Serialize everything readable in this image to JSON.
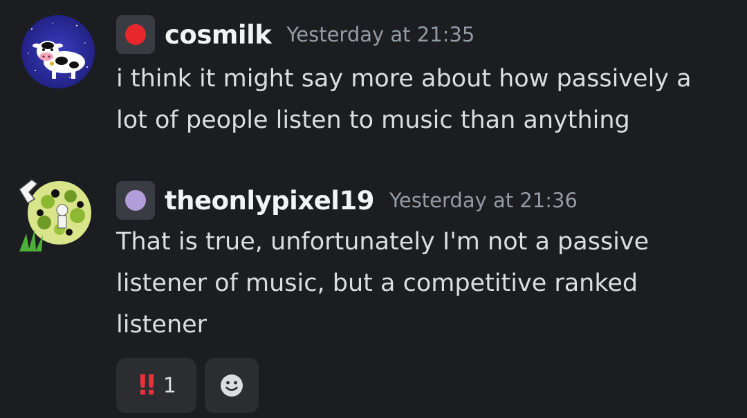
{
  "messages": [
    {
      "username": "cosmilk",
      "timestamp": "Yesterday at 21:35",
      "badge_color": "#e8272c",
      "lines": [
        "i think it might say more about how passively a",
        "lot of people listen to music than anything"
      ]
    },
    {
      "username": "theonlypixel19",
      "timestamp": "Yesterday at 21:36",
      "badge_color": "#b39ddb",
      "lines": [
        "That is true, unfortunately I'm not a passive",
        "listener of music, but a competitive ranked",
        "listener"
      ]
    }
  ],
  "reactions": [
    {
      "emoji": "!!",
      "emoji_icon": "double-exclamation-icon",
      "count": "1"
    }
  ],
  "add_reaction_icon": "smiley-face-icon",
  "colors": {
    "background": "#1c1d21",
    "username": "#f2f3f5",
    "timestamp": "#949ba4",
    "text": "#dbdee1",
    "reaction_bg": "#2b2d31",
    "reaction_emoji": "#e8323c"
  }
}
